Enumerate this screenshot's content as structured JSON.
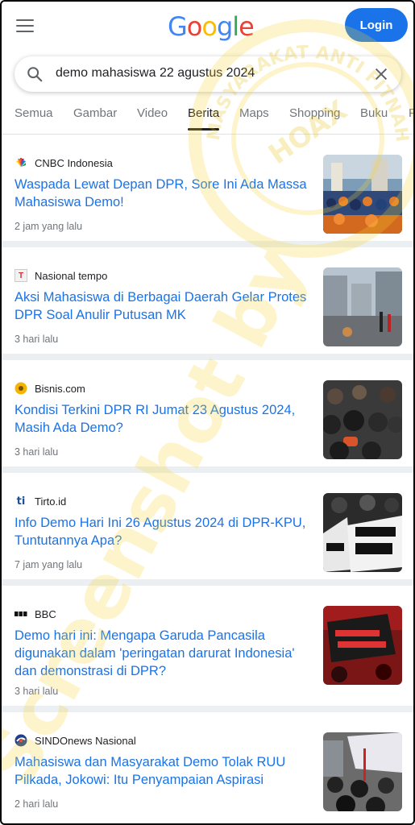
{
  "header": {
    "logo_letters": [
      "G",
      "o",
      "o",
      "g",
      "l",
      "e"
    ],
    "logo_colors": [
      "#4285f4",
      "#ea4335",
      "#fbbc05",
      "#4285f4",
      "#34a853",
      "#ea4335"
    ],
    "login_label": "Login"
  },
  "search": {
    "query": "demo mahasiswa 22 agustus 2024"
  },
  "tabs": [
    "Semua",
    "Gambar",
    "Video",
    "Berita",
    "Maps",
    "Shopping",
    "Buku",
    "P"
  ],
  "active_tab": "Berita",
  "results": [
    {
      "source": "CNBC Indonesia",
      "title": "Waspada Lewat Depan DPR, Sore Ini Ada Massa Mahasiswa Demo!",
      "time": "2 jam yang lalu",
      "favicon": "nbc-peacock-icon"
    },
    {
      "source": "Nasional tempo",
      "title": "Aksi Mahasiswa di Berbagai Daerah Gelar Protes DPR Soal Anulir Putusan MK",
      "time": "3 hari lalu",
      "favicon": "tempo-t-icon",
      "favicon_text": "T"
    },
    {
      "source": "Bisnis.com",
      "title": "Kondisi Terkini DPR RI Jumat 23 Agustus 2024, Masih Ada Demo?",
      "time": "3 hari lalu",
      "favicon": "bisnis-icon"
    },
    {
      "source": "Tirto.id",
      "title": "Info Demo Hari Ini 26 Agustus 2024 di DPR-KPU, Tuntutannya Apa?",
      "time": "7 jam yang lalu",
      "favicon": "tirto-icon",
      "favicon_text": "ti"
    },
    {
      "source": "BBC",
      "title": "Demo hari ini: Mengapa Garuda Pancasila digunakan dalam 'peringatan darurat Indonesia' dan demonstrasi di DPR?",
      "time": "3 hari lalu",
      "favicon": "bbc-icon"
    },
    {
      "source": "SINDOnews Nasional",
      "title": "Mahasiswa dan Masyarakat Demo Tolak RUU Pilkada, Jokowi: Itu Penyampaian Aspirasi",
      "time": "2 hari lalu",
      "favicon": "sindonews-icon"
    }
  ],
  "watermark": {
    "stamp_text": "MASYARAKAT ANTI FITNAH INDONESIA",
    "stamp_center": "TURN BACK HOAX",
    "diagonal_text": "Screenshot by"
  },
  "colors": {
    "link": "#1a73e8",
    "accent": "#1a73e8",
    "watermark": "#f5d22e"
  }
}
